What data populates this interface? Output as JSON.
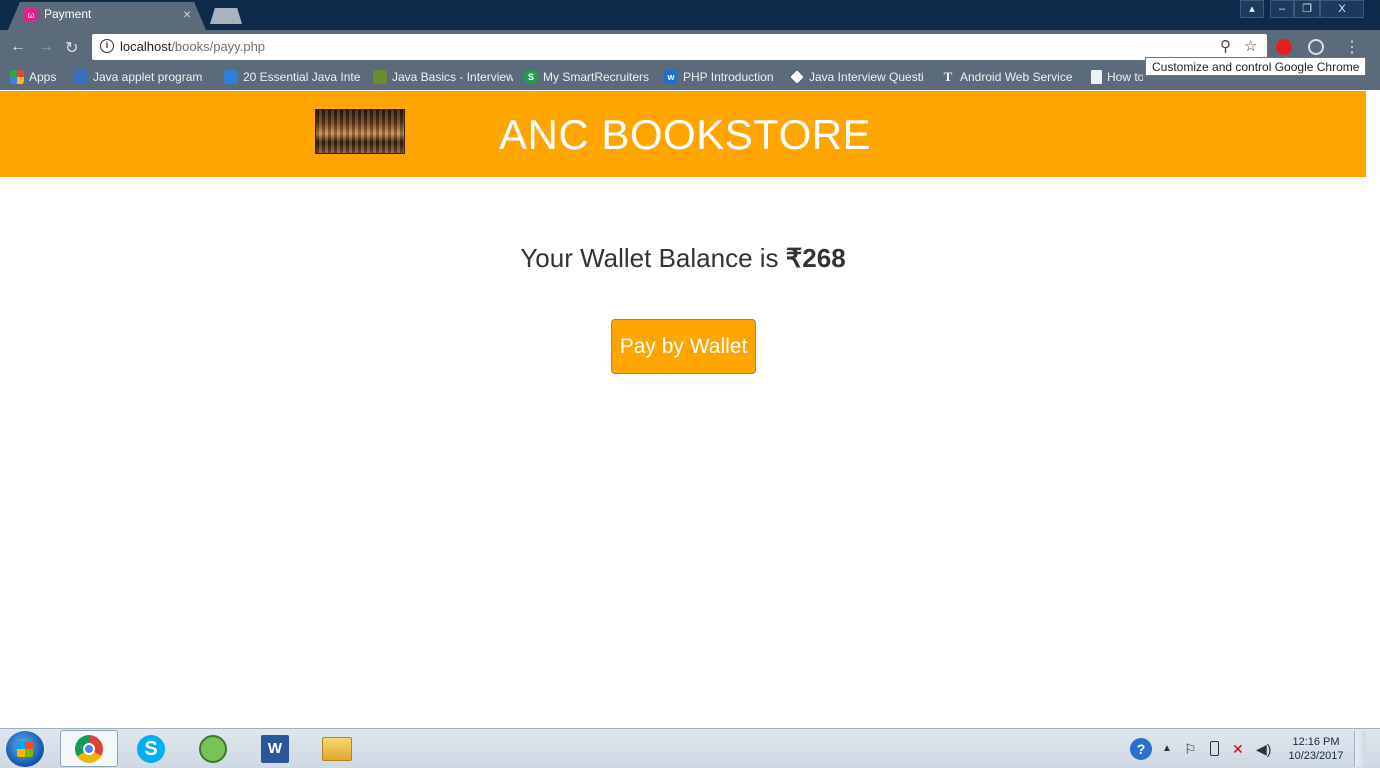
{
  "browser": {
    "tab_title": "Payment",
    "tab_close": "×",
    "window_controls": {
      "user": "▴",
      "minimize": "–",
      "restore": "❐",
      "close": "X"
    },
    "url_host": "localhost",
    "url_path": "/books/payy.php",
    "info_icon_glyph": "i",
    "tooltip": "Customize and control Google Chrome",
    "nav_icons": {
      "back": "←",
      "forward": "→",
      "reload": "↻",
      "zoom": "⚲",
      "star": "☆",
      "menu": "⋮"
    }
  },
  "bookmarks": [
    {
      "label": "Apps",
      "icon": "apps-icon",
      "color": "#e8453c"
    },
    {
      "label": "Java applet program",
      "icon": "java-icon",
      "color": "#3b6fc2"
    },
    {
      "label": "20 Essential Java Inte",
      "icon": "toptal-icon",
      "color": "#2f7fd6"
    },
    {
      "label": "Java Basics - Interview",
      "icon": "pickaxe-icon",
      "color": "#6a8c2a"
    },
    {
      "label": "My SmartRecruiters",
      "icon": "smartrecruiters-icon",
      "color": "#1aa34a"
    },
    {
      "label": "PHP Introduction",
      "icon": "w3schools-icon",
      "color": "#1f6fd1"
    },
    {
      "label": "Java Interview Questi",
      "icon": "diamond-icon",
      "color": "#555555"
    },
    {
      "label": "Android Web Service",
      "icon": "t-icon",
      "color": "#444444"
    },
    {
      "label": "How to create and",
      "icon": "page-icon",
      "color": "#9aa3ad"
    }
  ],
  "page": {
    "store_title": "ANC BOOKSTORE",
    "balance_prefix": "Your Wallet Balance is ",
    "balance_amount": "₹268",
    "pay_button": "Pay by Wallet",
    "header_color": "#ffa500"
  },
  "taskbar": {
    "apps": [
      {
        "name": "chrome-icon",
        "active": true
      },
      {
        "name": "skype-icon",
        "active": false
      },
      {
        "name": "android-studio-icon",
        "active": false
      },
      {
        "name": "word-icon",
        "active": false
      },
      {
        "name": "file-explorer-icon",
        "active": false
      }
    ],
    "time": "12:16 PM",
    "date": "10/23/2017"
  }
}
